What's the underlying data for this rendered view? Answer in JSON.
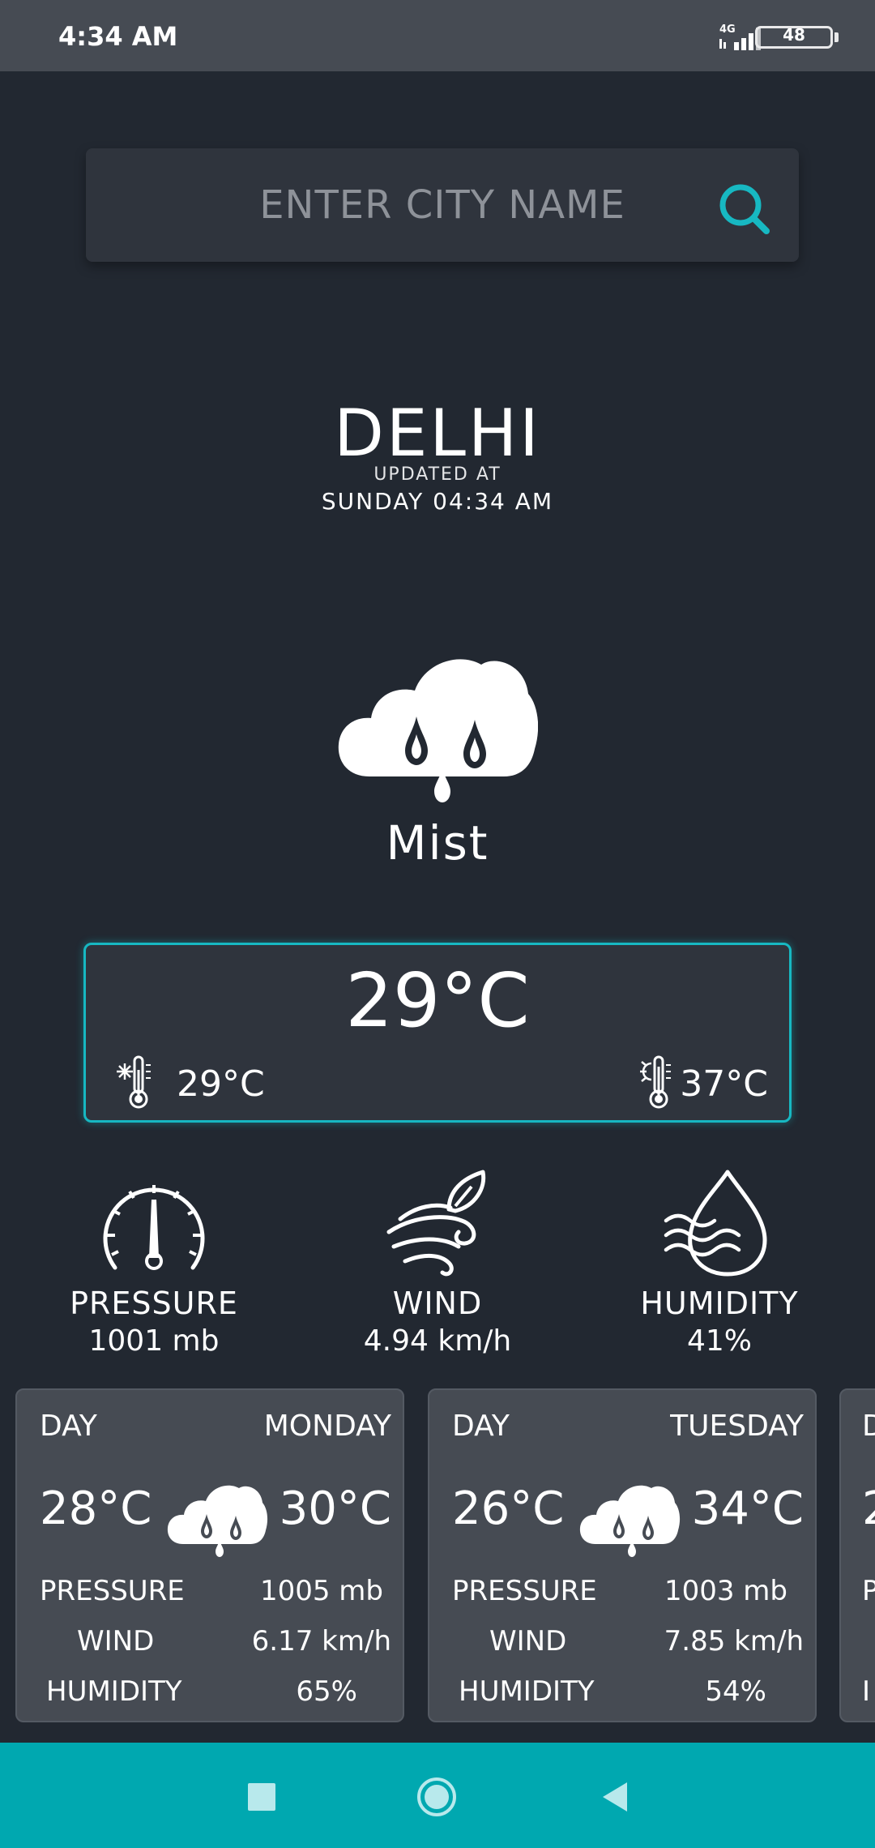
{
  "status_bar": {
    "time": "4:34 AM",
    "network": "4G",
    "battery": "48"
  },
  "search": {
    "placeholder": "ENTER CITY NAME",
    "icon": "search-icon"
  },
  "location": {
    "city": "DELHI",
    "updated_label": "UPDATED AT",
    "updated_time": "SUNDAY 04:34 AM"
  },
  "current": {
    "icon": "cloud-rain-icon",
    "condition": "Mist",
    "temp": "29°C",
    "temp_min": "29°C",
    "temp_max": "37°C"
  },
  "metrics": [
    {
      "label": "PRESSURE",
      "value": "1001 mb",
      "icon": "gauge-icon"
    },
    {
      "label": "WIND",
      "value": "4.94 km/h",
      "icon": "wind-icon"
    },
    {
      "label": "HUMIDITY",
      "value": "41%",
      "icon": "humidity-icon"
    }
  ],
  "forecast": [
    {
      "day_label": "DAY",
      "day": "MONDAY",
      "min": "28°C",
      "max": "30°C",
      "pressure_label": "PRESSURE",
      "pressure": "1005 mb",
      "wind_label": "WIND",
      "wind": "6.17 km/h",
      "humidity_label": "HUMIDITY",
      "humidity": "65%"
    },
    {
      "day_label": "DAY",
      "day": "TUESDAY",
      "min": "26°C",
      "max": "34°C",
      "pressure_label": "PRESSURE",
      "pressure": "1003 mb",
      "wind_label": "WIND",
      "wind": "7.85 km/h",
      "humidity_label": "HUMIDITY",
      "humidity": "54%"
    },
    {
      "day_label": "D",
      "day": "",
      "min": "2",
      "max": "",
      "pressure_label": "P",
      "pressure": "",
      "wind_label": "",
      "wind": "",
      "humidity_label": "I",
      "humidity": ""
    }
  ],
  "colors": {
    "background": "#222831",
    "card": "#2f343d",
    "forecast_card": "#464b53",
    "accent": "#17b8c2",
    "navbar": "#00a8b0"
  }
}
